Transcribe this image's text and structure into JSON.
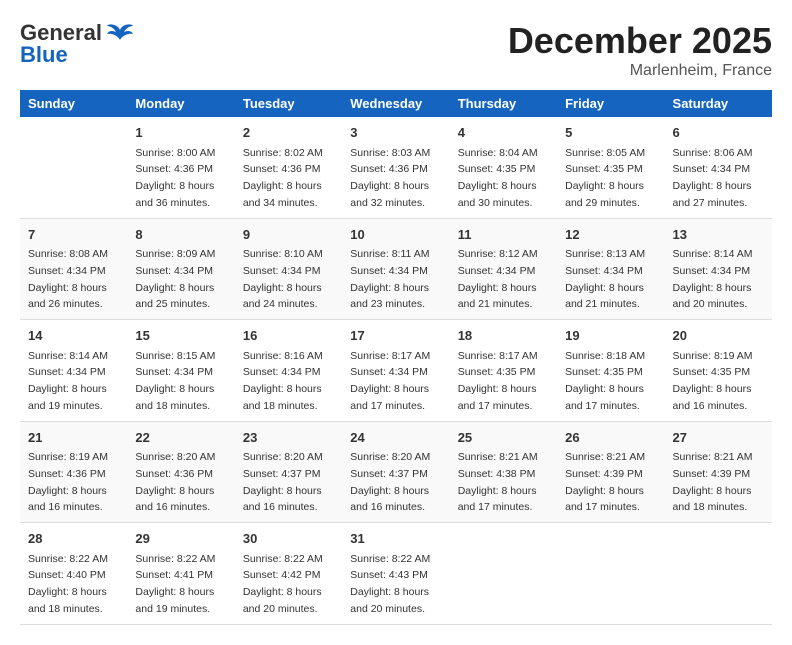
{
  "header": {
    "logo_general": "General",
    "logo_blue": "Blue",
    "month_title": "December 2025",
    "subtitle": "Marlenheim, France"
  },
  "days_of_week": [
    "Sunday",
    "Monday",
    "Tuesday",
    "Wednesday",
    "Thursday",
    "Friday",
    "Saturday"
  ],
  "weeks": [
    [
      {
        "day": "",
        "sunrise": "",
        "sunset": "",
        "daylight": ""
      },
      {
        "day": "1",
        "sunrise": "Sunrise: 8:00 AM",
        "sunset": "Sunset: 4:36 PM",
        "daylight": "Daylight: 8 hours and 36 minutes."
      },
      {
        "day": "2",
        "sunrise": "Sunrise: 8:02 AM",
        "sunset": "Sunset: 4:36 PM",
        "daylight": "Daylight: 8 hours and 34 minutes."
      },
      {
        "day": "3",
        "sunrise": "Sunrise: 8:03 AM",
        "sunset": "Sunset: 4:36 PM",
        "daylight": "Daylight: 8 hours and 32 minutes."
      },
      {
        "day": "4",
        "sunrise": "Sunrise: 8:04 AM",
        "sunset": "Sunset: 4:35 PM",
        "daylight": "Daylight: 8 hours and 30 minutes."
      },
      {
        "day": "5",
        "sunrise": "Sunrise: 8:05 AM",
        "sunset": "Sunset: 4:35 PM",
        "daylight": "Daylight: 8 hours and 29 minutes."
      },
      {
        "day": "6",
        "sunrise": "Sunrise: 8:06 AM",
        "sunset": "Sunset: 4:34 PM",
        "daylight": "Daylight: 8 hours and 27 minutes."
      }
    ],
    [
      {
        "day": "7",
        "sunrise": "Sunrise: 8:08 AM",
        "sunset": "Sunset: 4:34 PM",
        "daylight": "Daylight: 8 hours and 26 minutes."
      },
      {
        "day": "8",
        "sunrise": "Sunrise: 8:09 AM",
        "sunset": "Sunset: 4:34 PM",
        "daylight": "Daylight: 8 hours and 25 minutes."
      },
      {
        "day": "9",
        "sunrise": "Sunrise: 8:10 AM",
        "sunset": "Sunset: 4:34 PM",
        "daylight": "Daylight: 8 hours and 24 minutes."
      },
      {
        "day": "10",
        "sunrise": "Sunrise: 8:11 AM",
        "sunset": "Sunset: 4:34 PM",
        "daylight": "Daylight: 8 hours and 23 minutes."
      },
      {
        "day": "11",
        "sunrise": "Sunrise: 8:12 AM",
        "sunset": "Sunset: 4:34 PM",
        "daylight": "Daylight: 8 hours and 21 minutes."
      },
      {
        "day": "12",
        "sunrise": "Sunrise: 8:13 AM",
        "sunset": "Sunset: 4:34 PM",
        "daylight": "Daylight: 8 hours and 21 minutes."
      },
      {
        "day": "13",
        "sunrise": "Sunrise: 8:14 AM",
        "sunset": "Sunset: 4:34 PM",
        "daylight": "Daylight: 8 hours and 20 minutes."
      }
    ],
    [
      {
        "day": "14",
        "sunrise": "Sunrise: 8:14 AM",
        "sunset": "Sunset: 4:34 PM",
        "daylight": "Daylight: 8 hours and 19 minutes."
      },
      {
        "day": "15",
        "sunrise": "Sunrise: 8:15 AM",
        "sunset": "Sunset: 4:34 PM",
        "daylight": "Daylight: 8 hours and 18 minutes."
      },
      {
        "day": "16",
        "sunrise": "Sunrise: 8:16 AM",
        "sunset": "Sunset: 4:34 PM",
        "daylight": "Daylight: 8 hours and 18 minutes."
      },
      {
        "day": "17",
        "sunrise": "Sunrise: 8:17 AM",
        "sunset": "Sunset: 4:34 PM",
        "daylight": "Daylight: 8 hours and 17 minutes."
      },
      {
        "day": "18",
        "sunrise": "Sunrise: 8:17 AM",
        "sunset": "Sunset: 4:35 PM",
        "daylight": "Daylight: 8 hours and 17 minutes."
      },
      {
        "day": "19",
        "sunrise": "Sunrise: 8:18 AM",
        "sunset": "Sunset: 4:35 PM",
        "daylight": "Daylight: 8 hours and 17 minutes."
      },
      {
        "day": "20",
        "sunrise": "Sunrise: 8:19 AM",
        "sunset": "Sunset: 4:35 PM",
        "daylight": "Daylight: 8 hours and 16 minutes."
      }
    ],
    [
      {
        "day": "21",
        "sunrise": "Sunrise: 8:19 AM",
        "sunset": "Sunset: 4:36 PM",
        "daylight": "Daylight: 8 hours and 16 minutes."
      },
      {
        "day": "22",
        "sunrise": "Sunrise: 8:20 AM",
        "sunset": "Sunset: 4:36 PM",
        "daylight": "Daylight: 8 hours and 16 minutes."
      },
      {
        "day": "23",
        "sunrise": "Sunrise: 8:20 AM",
        "sunset": "Sunset: 4:37 PM",
        "daylight": "Daylight: 8 hours and 16 minutes."
      },
      {
        "day": "24",
        "sunrise": "Sunrise: 8:20 AM",
        "sunset": "Sunset: 4:37 PM",
        "daylight": "Daylight: 8 hours and 16 minutes."
      },
      {
        "day": "25",
        "sunrise": "Sunrise: 8:21 AM",
        "sunset": "Sunset: 4:38 PM",
        "daylight": "Daylight: 8 hours and 17 minutes."
      },
      {
        "day": "26",
        "sunrise": "Sunrise: 8:21 AM",
        "sunset": "Sunset: 4:39 PM",
        "daylight": "Daylight: 8 hours and 17 minutes."
      },
      {
        "day": "27",
        "sunrise": "Sunrise: 8:21 AM",
        "sunset": "Sunset: 4:39 PM",
        "daylight": "Daylight: 8 hours and 18 minutes."
      }
    ],
    [
      {
        "day": "28",
        "sunrise": "Sunrise: 8:22 AM",
        "sunset": "Sunset: 4:40 PM",
        "daylight": "Daylight: 8 hours and 18 minutes."
      },
      {
        "day": "29",
        "sunrise": "Sunrise: 8:22 AM",
        "sunset": "Sunset: 4:41 PM",
        "daylight": "Daylight: 8 hours and 19 minutes."
      },
      {
        "day": "30",
        "sunrise": "Sunrise: 8:22 AM",
        "sunset": "Sunset: 4:42 PM",
        "daylight": "Daylight: 8 hours and 20 minutes."
      },
      {
        "day": "31",
        "sunrise": "Sunrise: 8:22 AM",
        "sunset": "Sunset: 4:43 PM",
        "daylight": "Daylight: 8 hours and 20 minutes."
      },
      {
        "day": "",
        "sunrise": "",
        "sunset": "",
        "daylight": ""
      },
      {
        "day": "",
        "sunrise": "",
        "sunset": "",
        "daylight": ""
      },
      {
        "day": "",
        "sunrise": "",
        "sunset": "",
        "daylight": ""
      }
    ]
  ]
}
